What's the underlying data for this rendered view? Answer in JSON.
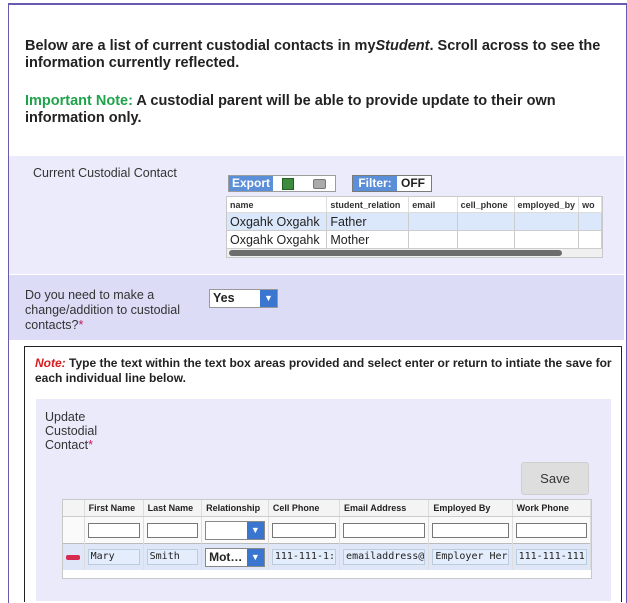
{
  "intro": {
    "part1": "Below are a list of current custodial contacts in my",
    "app_name": "Student",
    "part2": ".  Scroll across to see the information currently reflected."
  },
  "note": {
    "label": "Important Note:",
    "text": " A custodial parent will be able to provide update to their own information only."
  },
  "current_contacts": {
    "label": "Current Custodial Contact",
    "export_label": "Export",
    "filter_label": "Filter:",
    "filter_value": "OFF",
    "columns": [
      "name",
      "student_relation",
      "email",
      "cell_phone",
      "employed_by",
      "wo"
    ],
    "rows": [
      [
        "Oxgahk Oxgahk",
        "Father",
        "",
        "",
        "",
        ""
      ],
      [
        "Oxgahk Oxgahk",
        "Mother",
        "",
        "",
        "",
        ""
      ]
    ]
  },
  "question": {
    "text": "Do you need to make a change/addition to custodial contacts?",
    "required_mark": "*",
    "selected": "Yes"
  },
  "instructions": {
    "note_label": "Note:",
    "text": " Type the text within the text box areas provided and select enter or return to intiate the save for each individual line below."
  },
  "update": {
    "label": "Update Custodial Contact",
    "required_mark": "*",
    "save_label": "Save",
    "columns": [
      "First Name",
      "Last Name",
      "Relationship",
      "Cell Phone",
      "Email Address",
      "Employed By",
      "Work Phone"
    ],
    "row": {
      "first_name": "Mary",
      "last_name": "Smith",
      "relationship": "Mot…",
      "cell_phone": "111-111-1:",
      "email": "emailaddress@",
      "employed_by": "Employer Her",
      "work_phone": "111-111-111"
    }
  }
}
